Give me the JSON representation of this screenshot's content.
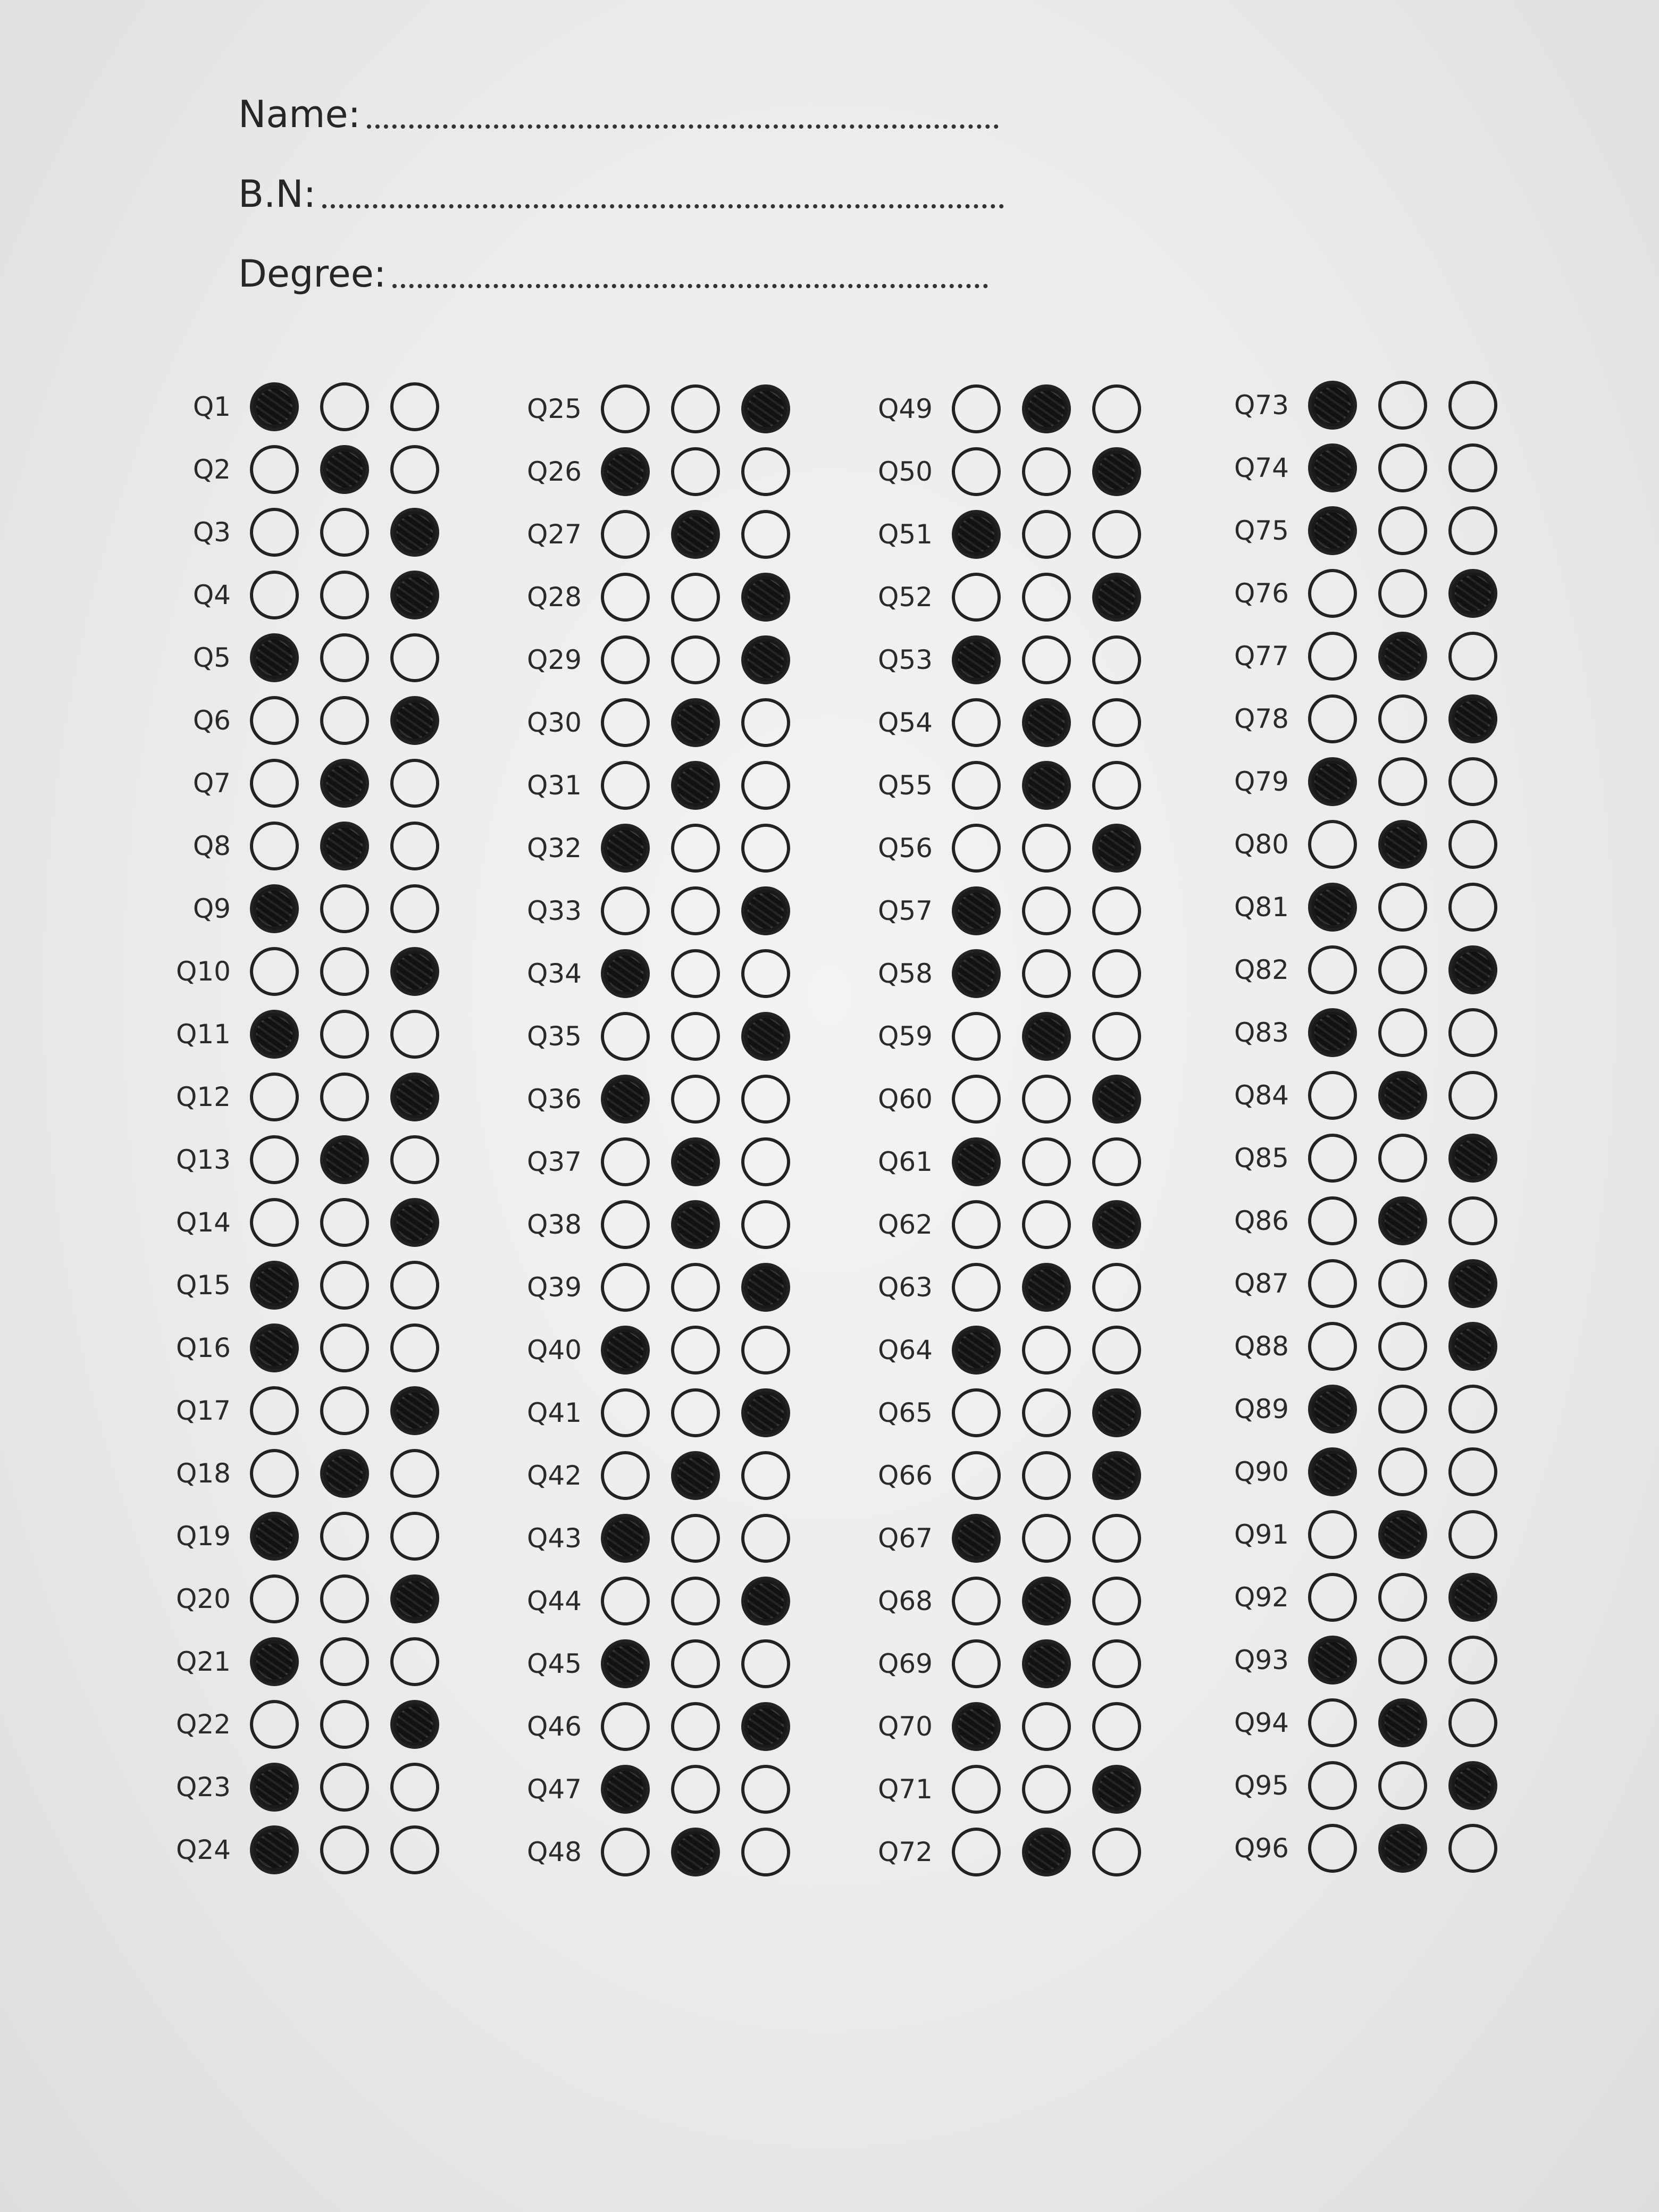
{
  "header": {
    "name_label": "Name:",
    "bn_label": "B.N:",
    "degree_label": "Degree:"
  },
  "answers": {
    "Q1": 1,
    "Q2": 2,
    "Q3": 3,
    "Q4": 3,
    "Q5": 1,
    "Q6": 3,
    "Q7": 2,
    "Q8": 2,
    "Q9": 1,
    "Q10": 3,
    "Q11": 1,
    "Q12": 3,
    "Q13": 2,
    "Q14": 3,
    "Q15": 1,
    "Q16": 1,
    "Q17": 3,
    "Q18": 2,
    "Q19": 1,
    "Q20": 3,
    "Q21": 1,
    "Q22": 3,
    "Q23": 1,
    "Q24": 1,
    "Q25": 3,
    "Q26": 1,
    "Q27": 2,
    "Q28": 3,
    "Q29": 3,
    "Q30": 2,
    "Q31": 2,
    "Q32": 1,
    "Q33": 3,
    "Q34": 1,
    "Q35": 3,
    "Q36": 1,
    "Q37": 2,
    "Q38": 2,
    "Q39": 3,
    "Q40": 1,
    "Q41": 3,
    "Q42": 2,
    "Q43": 1,
    "Q44": 3,
    "Q45": 1,
    "Q46": 3,
    "Q47": 1,
    "Q48": 2,
    "Q49": 2,
    "Q50": 3,
    "Q51": 1,
    "Q52": 3,
    "Q53": 1,
    "Q54": 2,
    "Q55": 2,
    "Q56": 3,
    "Q57": 1,
    "Q58": 1,
    "Q59": 2,
    "Q60": 3,
    "Q61": 1,
    "Q62": 3,
    "Q63": 2,
    "Q64": 1,
    "Q65": 3,
    "Q66": 3,
    "Q67": 1,
    "Q68": 2,
    "Q69": 2,
    "Q70": 1,
    "Q71": 3,
    "Q72": 2,
    "Q73": 1,
    "Q74": 1,
    "Q75": 1,
    "Q76": 3,
    "Q77": 2,
    "Q78": 3,
    "Q79": 1,
    "Q80": 2,
    "Q81": 1,
    "Q82": 3,
    "Q83": 1,
    "Q84": 2,
    "Q85": 3,
    "Q86": 2,
    "Q87": 3,
    "Q88": 3,
    "Q89": 1,
    "Q90": 1,
    "Q91": 2,
    "Q92": 3,
    "Q93": 1,
    "Q94": 2,
    "Q95": 3,
    "Q96": 2
  }
}
